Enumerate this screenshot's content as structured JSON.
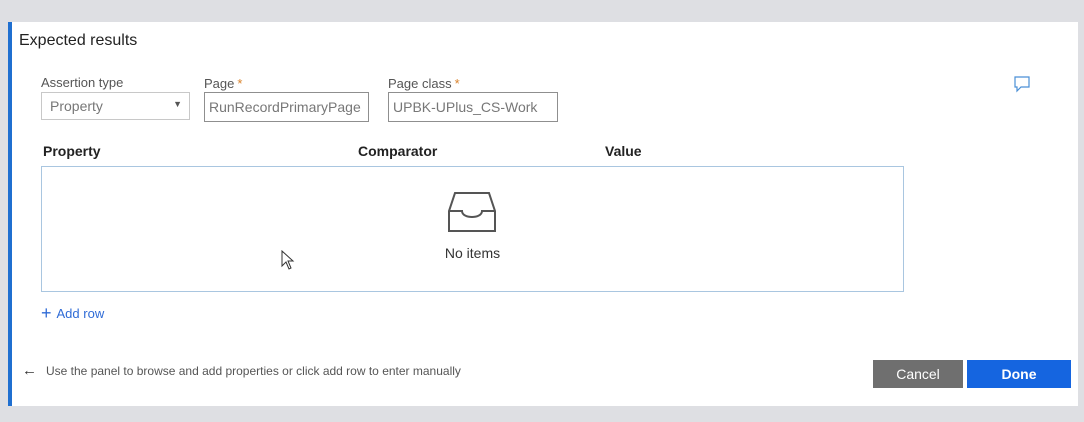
{
  "panel": {
    "title": "Expected results"
  },
  "fields": {
    "assertion_type": {
      "label": "Assertion type",
      "value": "Property"
    },
    "page": {
      "label": "Page",
      "required_mark": "*",
      "value": "RunRecordPrimaryPage"
    },
    "page_class": {
      "label": "Page class",
      "required_mark": "*",
      "value": "UPBK-UPlus_CS-Work"
    }
  },
  "table": {
    "columns": [
      "Property",
      "Comparator",
      "Value"
    ],
    "empty_text": "No items"
  },
  "actions": {
    "add_row": "Add row",
    "hint": "Use the panel to browse and add properties or click add row to enter manually",
    "cancel": "Cancel",
    "done": "Done"
  },
  "colors": {
    "accent": "#1f6fd0",
    "primary_button": "#1565e0",
    "secondary_button": "#6f6f6f",
    "required": "#d9822b",
    "link": "#2f6bd6"
  },
  "icons": {
    "comment": "comment-icon",
    "inbox": "inbox-icon",
    "add": "plus-icon",
    "back": "arrow-left-icon",
    "dropdown": "caret-down-icon"
  }
}
